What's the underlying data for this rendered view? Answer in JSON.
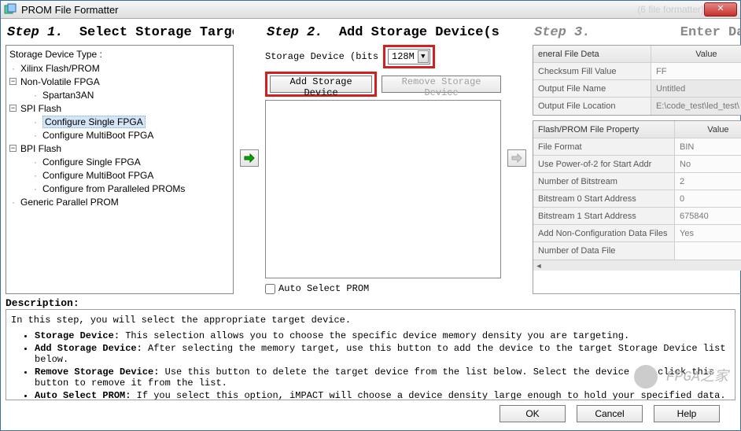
{
  "window": {
    "title": "PROM File Formatter",
    "ghost": "(6 file formatter)"
  },
  "step1": {
    "label": "Step 1.",
    "title": "Select Storage Target",
    "treeTitle": "Storage Device Type :",
    "tree": {
      "xilinx": "Xilinx Flash/PROM",
      "nonvol": "Non-Volatile FPGA",
      "spartan": "Spartan3AN",
      "spi": "SPI Flash",
      "spi1": "Configure Single FPGA",
      "spi2": "Configure MultiBoot FPGA",
      "bpi": "BPI Flash",
      "bpi1": "Configure Single FPGA",
      "bpi2": "Configure MultiBoot FPGA",
      "bpi3": "Configure from Paralleled PROMs",
      "generic": "Generic Parallel PROM"
    }
  },
  "step2": {
    "label": "Step 2.",
    "title": "Add Storage Device(s)",
    "sizeLabel": "Storage Device (bits",
    "sizeValue": "128M",
    "addBtn": "Add Storage Device",
    "removeBtn": "Remove Storage Device",
    "autoSelect": "Auto Select PROM"
  },
  "step3": {
    "label": "Step 3.",
    "title": "Enter Data",
    "fileDetails": {
      "header1": "eneral File Deta",
      "header2": "Value",
      "rows": [
        {
          "k": "Checksum Fill Value",
          "v": "FF"
        },
        {
          "k": "Output File Name",
          "v": "Untitled"
        },
        {
          "k": "Output File Location",
          "v": "E:\\code_test\\led_test\\"
        }
      ]
    },
    "props": {
      "header1": "Flash/PROM File Property",
      "header2": "Value",
      "rows": [
        {
          "k": "File Format",
          "v": "BIN"
        },
        {
          "k": "Use Power-of-2 for Start Addr",
          "v": "No"
        },
        {
          "k": "Number of Bitstream",
          "v": "2"
        },
        {
          "k": "Bitstream 0 Start Address",
          "v": "0"
        },
        {
          "k": "Bitstream 1 Start Address",
          "v": "675840"
        },
        {
          "k": "Add Non-Configuration Data Files",
          "v": "Yes"
        },
        {
          "k": "Number of Data File",
          "v": ""
        }
      ]
    }
  },
  "desc": {
    "label": "Description:",
    "intro": "In this step, you will select the appropriate target device.",
    "b1t": "Storage Device:",
    "b1": "This selection allows you to choose the specific device memory density you are targeting.",
    "b2t": "Add Storage Device:",
    "b2": "After selecting the memory target, use this button to add the device to the target Storage Device list below.",
    "b3t": "Remove Storage Device:",
    "b3": "Use this button to delete the target device from the list below. Select the device and click this button to remove it from the list.",
    "b4t": "Auto Select PROM:",
    "b4": "If you select this option, iMPACT will choose a device density large enough to hold your specified data."
  },
  "buttons": {
    "ok": "OK",
    "cancel": "Cancel",
    "help": "Help"
  },
  "watermark": "FPGA之家"
}
